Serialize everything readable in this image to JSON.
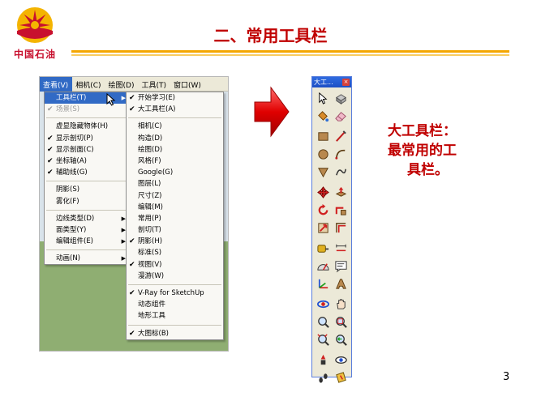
{
  "logo": {
    "name": "中国石油",
    "colors": {
      "red": "#c8102e",
      "yellow": "#f4b400"
    }
  },
  "slide": {
    "title": "二、常用工具栏",
    "page_number": "3"
  },
  "menubar": {
    "items": [
      {
        "label": "查看(V)",
        "active": true
      },
      {
        "label": "相机(C)"
      },
      {
        "label": "绘图(D)"
      },
      {
        "label": "工具(T)"
      },
      {
        "label": "窗口(W)"
      }
    ]
  },
  "view_menu": {
    "items": [
      {
        "label": "工具栏(T)",
        "submenu": true,
        "highlighted": true
      },
      {
        "label": "场景(S)",
        "checked": true,
        "disabled": true
      },
      {
        "sep": true
      },
      {
        "label": "虚显隐藏物体(H)"
      },
      {
        "label": "显示剖切(P)",
        "checked": true
      },
      {
        "label": "显示剖面(C)",
        "checked": true
      },
      {
        "label": "坐标轴(A)",
        "checked": true
      },
      {
        "label": "辅助线(G)",
        "checked": true
      },
      {
        "sep": true
      },
      {
        "label": "阴影(S)"
      },
      {
        "label": "雾化(F)"
      },
      {
        "sep": true
      },
      {
        "label": "边线类型(D)",
        "submenu": true
      },
      {
        "label": "面类型(Y)",
        "submenu": true
      },
      {
        "label": "编辑组件(E)",
        "submenu": true
      },
      {
        "sep": true
      },
      {
        "label": "动画(N)",
        "submenu": true
      }
    ]
  },
  "toolbars_submenu": {
    "items": [
      {
        "label": "开始学习(E)",
        "checked": true
      },
      {
        "label": "大工具栏(A)",
        "checked": true
      },
      {
        "sep": true
      },
      {
        "label": "相机(C)"
      },
      {
        "label": "构造(D)"
      },
      {
        "label": "绘图(D)"
      },
      {
        "label": "风格(F)"
      },
      {
        "label": "Google(G)"
      },
      {
        "label": "图层(L)"
      },
      {
        "label": "尺寸(Z)"
      },
      {
        "label": "编辑(M)"
      },
      {
        "label": "常用(P)"
      },
      {
        "label": "剖切(T)"
      },
      {
        "label": "阴影(H)",
        "checked": true
      },
      {
        "label": "标准(S)"
      },
      {
        "label": "视图(V)",
        "checked": true
      },
      {
        "label": "漫游(W)"
      },
      {
        "sep": true
      },
      {
        "label": "V-Ray for SketchUp",
        "checked": true
      },
      {
        "label": "动态组件"
      },
      {
        "label": "地形工具"
      },
      {
        "sep": true
      },
      {
        "label": "大图标(B)",
        "checked": true
      }
    ]
  },
  "large_toolbar": {
    "title": "大工...",
    "close_label": "×",
    "groups": [
      [
        "select-icon",
        "make-component-icon",
        "paint-bucket-icon",
        "eraser-icon"
      ],
      [
        "rectangle-icon",
        "line-icon",
        "circle-icon",
        "arc-icon",
        "polygon-icon",
        "freehand-icon"
      ],
      [
        "move-icon",
        "push-pull-icon",
        "rotate-icon",
        "follow-me-icon",
        "scale-icon",
        "offset-icon"
      ],
      [
        "tape-measure-icon",
        "dimension-icon",
        "protractor-icon",
        "text-icon",
        "axes-icon",
        "3d-text-icon"
      ],
      [
        "orbit-icon",
        "pan-icon",
        "zoom-icon",
        "zoom-window-icon",
        "zoom-extents-icon",
        "previous-view-icon"
      ],
      [
        "position-camera-icon",
        "look-around-icon",
        "walk-icon",
        "section-plane-icon"
      ]
    ]
  },
  "caption": {
    "line1": "大工具栏：",
    "line2": "最常用的工",
    "line3": "具栏。"
  }
}
